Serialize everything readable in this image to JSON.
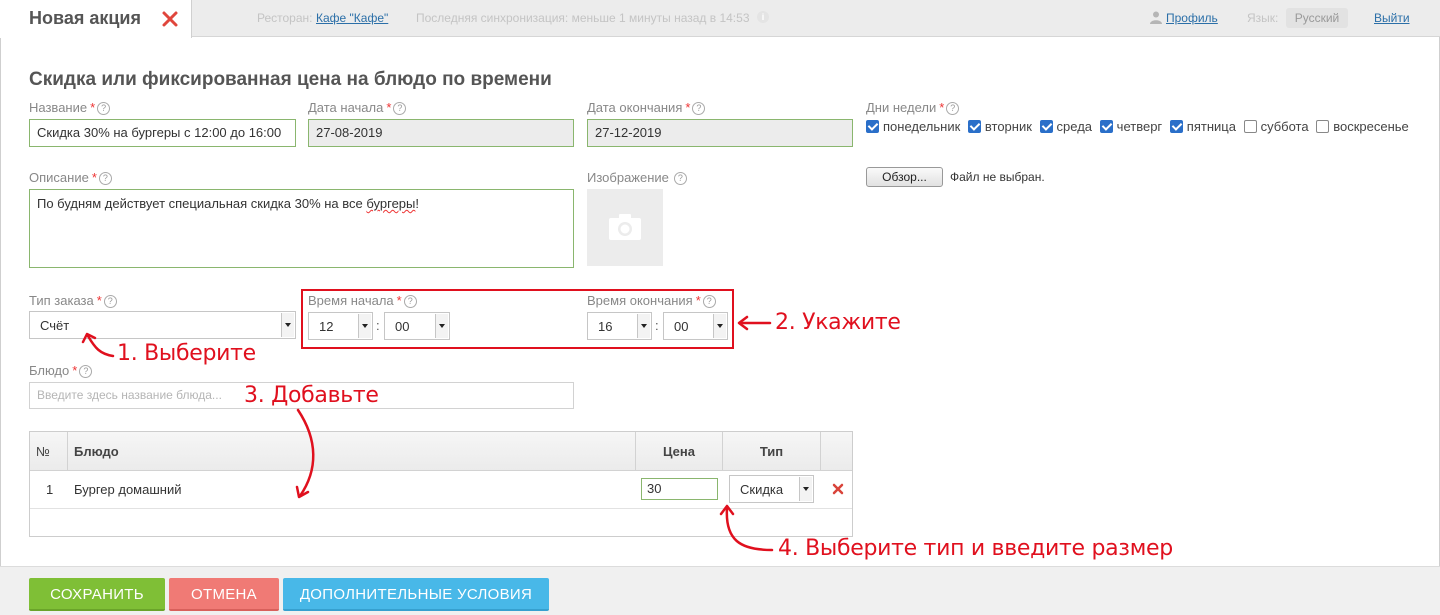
{
  "topbar": {
    "tab_title": "Новая акция",
    "restaurant_label": "Ресторан:",
    "restaurant_value": "Кафе \"Кафе\"",
    "sync_status": "Последняя синхронизация: меньше 1 минуты назад в 14:53",
    "profile_link": "Профиль",
    "language_label": "Язык:",
    "language_value": "Русский",
    "logout_link": "Выйти"
  },
  "form": {
    "title": "Скидка или фиксированная цена на блюдо по времени",
    "name_label": "Название",
    "name_value": "Скидка 30% на бургеры с 12:00 до 16:00",
    "start_date_label": "Дата начала",
    "start_date_value": "27-08-2019",
    "end_date_label": "Дата окончания",
    "end_date_value": "27-12-2019",
    "weekdays_label": "Дни недели",
    "weekdays": [
      {
        "label": "понедельник",
        "checked": true
      },
      {
        "label": "вторник",
        "checked": true
      },
      {
        "label": "среда",
        "checked": true
      },
      {
        "label": "четверг",
        "checked": true
      },
      {
        "label": "пятница",
        "checked": true
      },
      {
        "label": "суббота",
        "checked": false
      },
      {
        "label": "воскресенье",
        "checked": false
      }
    ],
    "description_label": "Описание",
    "description_before": "По будням действует специальная скидка 30% на все ",
    "description_misspelled": "бургеры",
    "description_after": "!",
    "image_label": "Изображение",
    "browse_button": "Обзор...",
    "no_file_text": "Файл не выбран.",
    "order_type_label": "Тип заказа",
    "order_type_value": "Счёт",
    "start_time_label": "Время начала",
    "start_hour": "12",
    "start_minute": "00",
    "end_time_label": "Время окончания",
    "end_hour": "16",
    "end_minute": "00",
    "time_separator": ":",
    "dish_label": "Блюдо",
    "dish_placeholder": "Введите здесь название блюда..."
  },
  "table": {
    "headers": {
      "num": "№",
      "dish": "Блюдо",
      "price": "Цена",
      "type": "Тип"
    },
    "rows": [
      {
        "num": "1",
        "dish": "Бургер домашний",
        "price": "30",
        "type": "Скидка"
      }
    ]
  },
  "annotations": {
    "step1": "1. Выберите",
    "step2": "2. Укажите",
    "step3": "3. Добавьте",
    "step4": "4. Выберите тип и введите размер"
  },
  "footer": {
    "save": "СОХРАНИТЬ",
    "cancel": "ОТМЕНА",
    "extra": "ДОПОЛНИТЕЛЬНЫЕ УСЛОВИЯ"
  },
  "required_mark": "*",
  "help_mark": "?",
  "colors": {
    "accent_red": "#e0101e",
    "save_green": "#7fbf36",
    "cancel_red": "#f07a75",
    "extra_blue": "#48b8e8",
    "valid_border": "#8ab66e"
  },
  "icons": {
    "close": "close-icon",
    "user": "user-icon",
    "info": "info-icon",
    "camera": "camera-icon",
    "delete": "delete-icon",
    "dropdown": "chevron-down-icon"
  }
}
